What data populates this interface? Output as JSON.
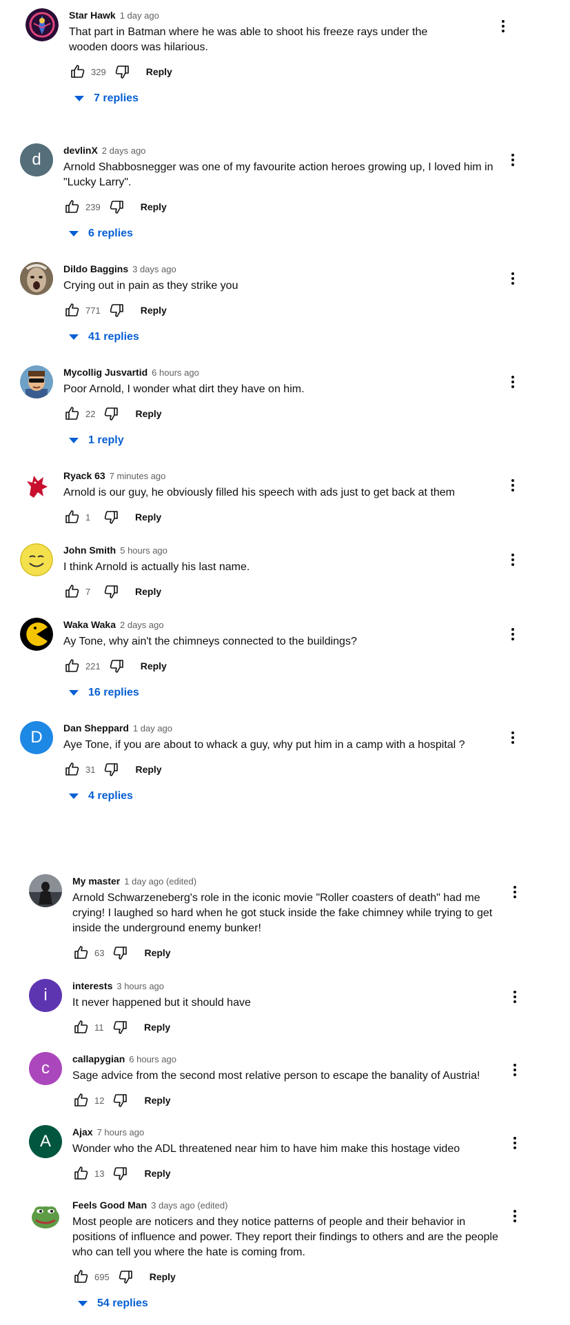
{
  "icons": {
    "like": "thumbs-up-icon",
    "dislike": "thumbs-down-icon",
    "menu": "more-vert-icon",
    "expand": "caret-down-icon"
  },
  "colors": {
    "link": "#065fd4",
    "secondary": "#606060",
    "text": "#0f0f0f"
  },
  "comments": [
    {
      "author": "Star Hawk",
      "time": "1 day ago",
      "text": "That part in Batman where he was able to shoot his freeze rays under the wooden doors was hilarious.",
      "likes": "329",
      "reply_label": "Reply",
      "replies_label": "7 replies",
      "avatar": "starhawk"
    },
    {
      "author": "devlinX",
      "time": "2 days ago",
      "text": "Arnold Shabbosnegger was one of my favourite action heroes growing up, I loved him in \"Lucky Larry\".",
      "likes": "239",
      "reply_label": "Reply",
      "replies_label": "6 replies",
      "avatar_letter": "d",
      "avatar_color": "#546e7a"
    },
    {
      "author": "Dildo Baggins",
      "time": "3 days ago",
      "text": "Crying out in pain as they strike you",
      "likes": "771",
      "reply_label": "Reply",
      "replies_label": "41 replies",
      "avatar": "photo-face"
    },
    {
      "author": "Mycollig Jusvartid",
      "time": "6 hours ago",
      "text": "Poor Arnold, I wonder what dirt they have on him.",
      "likes": "22",
      "reply_label": "Reply",
      "replies_label": "1 reply",
      "avatar": "cartoon-man"
    },
    {
      "author": "Ryack 63",
      "time": "7 minutes ago",
      "text": "Arnold is our guy, he obviously filled his speech with ads just to get back at them",
      "likes": "1",
      "reply_label": "Reply",
      "avatar": "griffin"
    },
    {
      "author": "John Smith",
      "time": "5 hours ago",
      "text": "I think Arnold is actually his last name.",
      "likes": "7",
      "reply_label": "Reply",
      "avatar": "smiley"
    },
    {
      "author": "Waka Waka",
      "time": "2 days ago",
      "text": "Ay Tone, why ain't the chimneys connected to the buildings?",
      "likes": "221",
      "reply_label": "Reply",
      "replies_label": "16 replies",
      "avatar": "pacman"
    },
    {
      "author": "Dan Sheppard",
      "time": "1 day ago",
      "text": "Aye Tone, if you are about to whack a guy, why put him in a camp with a hospital ?",
      "likes": "31",
      "reply_label": "Reply",
      "replies_label": "4 replies",
      "avatar_letter": "D",
      "avatar_color": "#1e88e5"
    },
    {
      "author": "My master",
      "time": "1 day ago (edited)",
      "text": "Arnold Schwarzeneberg's role in the iconic movie \"Roller coasters of death\" had me crying! I laughed so hard when he got stuck inside the fake chimney while trying to get inside the underground enemy bunker!",
      "likes": "63",
      "reply_label": "Reply",
      "avatar": "silhouette"
    },
    {
      "author": "interests",
      "time": "3 hours ago",
      "text": "It never happened but it should have",
      "likes": "11",
      "reply_label": "Reply",
      "avatar_letter": "i",
      "avatar_color": "#5e35b1"
    },
    {
      "author": "callapygian",
      "time": "6 hours ago",
      "text": "Sage advice from the second most relative person to escape the banality of Austria!",
      "likes": "12",
      "reply_label": "Reply",
      "avatar_letter": "c",
      "avatar_color": "#ab47bc"
    },
    {
      "author": "Ajax",
      "time": "7 hours ago",
      "text": "Wonder who the ADL threatened near him to have him make this hostage video",
      "likes": "13",
      "reply_label": "Reply",
      "avatar_letter": "A",
      "avatar_color": "#00563f"
    },
    {
      "author": "Feels Good Man",
      "time": "3 days ago (edited)",
      "text": "Most people are noticers and they notice patterns of people and their behavior in positions of influence and power. They report their findings to others and are the people who can tell you where the hate is coming from.",
      "likes": "695",
      "reply_label": "Reply",
      "replies_label": "54 replies",
      "avatar": "frog"
    }
  ]
}
